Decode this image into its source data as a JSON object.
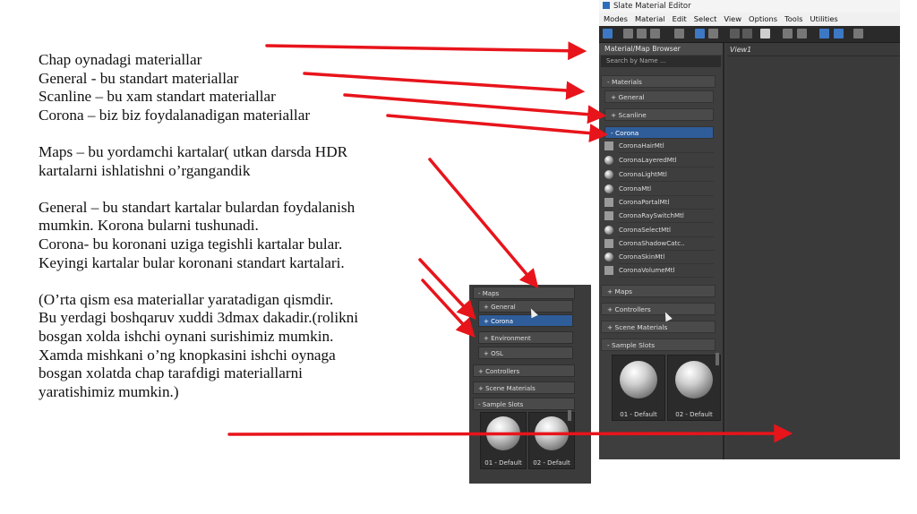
{
  "text": {
    "lines": [
      "Chap oynadagi materiallar",
      "General  -  bu standart materiallar",
      "Scanline – bu xam standart materiallar",
      "Corona – biz biz foydalanadigan materiallar",
      "",
      "Maps – bu yordamchi kartalar( utkan darsda HDR",
      "kartalarni ishlatishni o’rgangandik",
      "",
      "General – bu standart kartalar bulardan foydalanish",
      "mumkin. Korona bularni tushunadi.",
      "Corona- bu koronani uziga tegishli kartalar bular.",
      "Keyingi kartalar bular koronani standart kartalari.",
      "",
      "(O’rta qism esa materiallar yaratadigan qismdir.",
      "Bu yerdagi boshqaruv xuddi 3dmax dakadir.(rolikni",
      "bosgan xolda ishchi oynani surishimiz mumkin.",
      "Xamda mishkani o’ng knopkasini ishchi oynaga",
      "bosgan xolatda chap tarafdigi materiallarni",
      "yaratishimiz mumkin.)"
    ]
  },
  "editor": {
    "title": "Slate Material Editor",
    "menu": [
      "Modes",
      "Material",
      "Edit",
      "Select",
      "View",
      "Options",
      "Tools",
      "Utilities"
    ],
    "browser_title": "Material/Map Browser",
    "search_placeholder": "Search by Name ...",
    "view_tab": "View1",
    "groups": {
      "materials": "- Materials",
      "general": "+ General",
      "scanline": "+ Scanline",
      "corona": "- Corona",
      "maps": "+ Maps",
      "controllers": "+ Controllers",
      "scene_materials": "+ Scene Materials",
      "sample_slots": "- Sample Slots"
    },
    "corona_items": [
      "CoronaHairMtl",
      "CoronaLayeredMtl",
      "CoronaLightMtl",
      "CoronaMtl",
      "CoronaPortalMtl",
      "CoronaRaySwitchMtl",
      "CoronaSelectMtl",
      "CoronaShadowCatc..",
      "CoronaSkinMtl",
      "CoronaVolumeMtl"
    ],
    "slots": [
      "01 - Default",
      "02 - Default"
    ]
  },
  "panel2": {
    "maps": "- Maps",
    "general": "+ General",
    "corona": "+ Corona",
    "environment": "+ Environment",
    "osl": "+ OSL",
    "controllers": "+ Controllers",
    "scene_materials": "+ Scene Materials",
    "sample_slots": "- Sample Slots",
    "slots": [
      "01 - Default",
      "02 - Default"
    ]
  },
  "colors": {
    "arrow": "#e8141b",
    "selected": "#2f5d9a",
    "panel_bg": "#3c3c3c"
  }
}
